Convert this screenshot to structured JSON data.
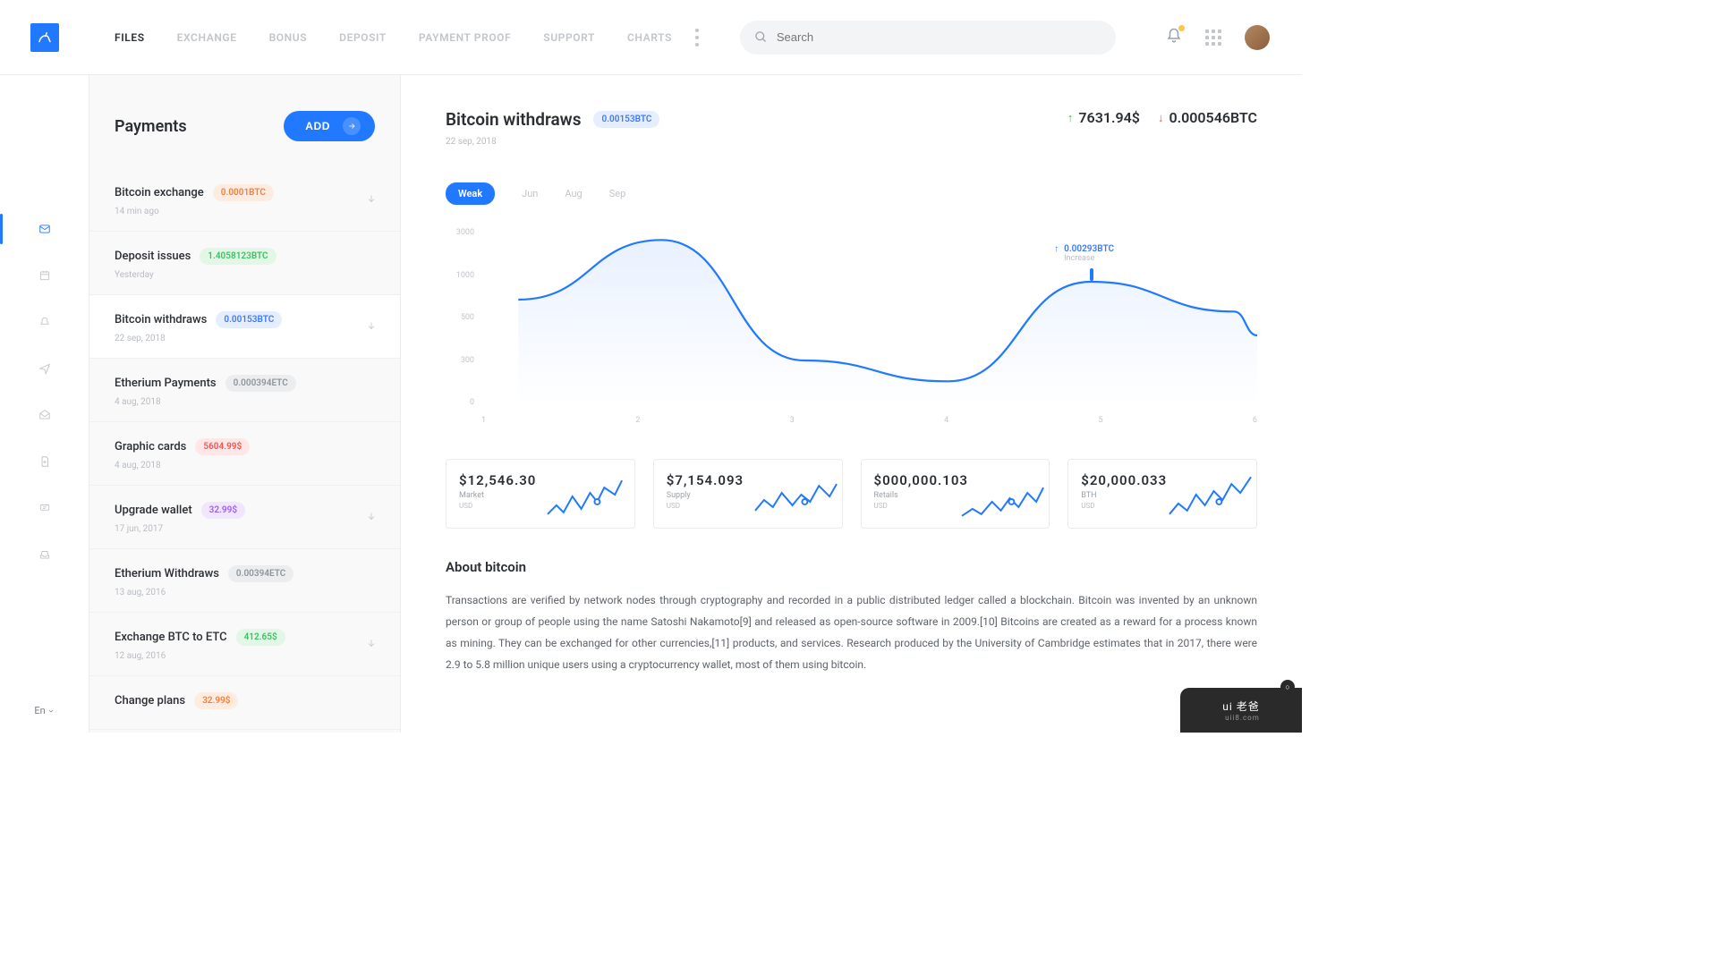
{
  "header": {
    "nav": [
      "FILES",
      "EXCHANGE",
      "BONUS",
      "DEPOSIT",
      "PAYMENT PROOF",
      "SUPPORT",
      "CHARTS"
    ],
    "active_nav": 0,
    "search_placeholder": "Search"
  },
  "rail": {
    "lang": "En"
  },
  "payments": {
    "title": "Payments",
    "add_label": "ADD",
    "items": [
      {
        "name": "Bitcoin exchange",
        "badge": "0.0001BTC",
        "badge_class": "b-orange",
        "date": "14 min ago",
        "arrow": true
      },
      {
        "name": "Deposit issues",
        "badge": "1.4058123BTC",
        "badge_class": "b-green",
        "date": "Yesterday",
        "arrow": false
      },
      {
        "name": "Bitcoin withdraws",
        "badge": "0.00153BTC",
        "badge_class": "b-blue",
        "date": "22 sep, 2018",
        "arrow": true,
        "selected": true
      },
      {
        "name": "Etherium Payments",
        "badge": "0.000394ETC",
        "badge_class": "b-grey",
        "date": "4 aug, 2018",
        "arrow": false
      },
      {
        "name": "Graphic cards",
        "badge": "5604.99$",
        "badge_class": "b-red",
        "date": "4 aug, 2018",
        "arrow": false
      },
      {
        "name": "Upgrade wallet",
        "badge": "32.99$",
        "badge_class": "b-purple",
        "date": "17 jun, 2017",
        "arrow": true
      },
      {
        "name": "Etherium Withdraws",
        "badge": "0.00394ETC",
        "badge_class": "b-grey",
        "date": "13 aug, 2016",
        "arrow": false
      },
      {
        "name": "Exchange BTC to ETC",
        "badge": "412.65$",
        "badge_class": "b-green",
        "date": "12 aug, 2016",
        "arrow": true
      },
      {
        "name": "Change plans",
        "badge": "32.99$",
        "badge_class": "b-orange",
        "date": "",
        "arrow": false
      }
    ]
  },
  "detail": {
    "title": "Bitcoin withdraws",
    "badge": "0.00153BTC",
    "date": "22 sep, 2018",
    "stat_up": "7631.94$",
    "stat_down": "0.000546BTC",
    "range_tabs": [
      "Weak",
      "Jun",
      "Aug",
      "Sep"
    ],
    "active_range": 0,
    "marker_value": "0.00293BTC",
    "marker_label": "Increase",
    "about_title": "About bitcoin",
    "about_body": "Transactions are verified by network nodes through cryptography and recorded in a public distributed ledger called a blockchain. Bitcoin was invented by an unknown person or group of people using the name Satoshi Nakamoto[9] and released as open-source software in 2009.[10] Bitcoins are created as a reward for a process known as mining. They can be exchanged for other currencies,[11] products, and services. Research produced by the University of Cambridge estimates that in 2017, there were 2.9 to 5.8 million unique users using a cryptocurrency wallet, most of them using bitcoin."
  },
  "chart_data": {
    "type": "line",
    "x": [
      1,
      2,
      3,
      4,
      5,
      6
    ],
    "values": [
      1800,
      2800,
      780,
      430,
      2100,
      1600
    ],
    "y_ticks": [
      3000,
      1000,
      500,
      300,
      0
    ],
    "x_ticks": [
      "1",
      "2",
      "3",
      "4",
      "5",
      "6"
    ],
    "ylim": [
      0,
      3000
    ]
  },
  "cards": [
    {
      "value": "$12,546.30",
      "label": "Market",
      "unit": "USD"
    },
    {
      "value": "$7,154.093",
      "label": "Supply",
      "unit": "USD"
    },
    {
      "value": "$000,000.103",
      "label": "Retails",
      "unit": "USD"
    },
    {
      "value": "$20,000.033",
      "label": "BTH",
      "unit": "USD"
    }
  ],
  "watermark": {
    "brand": "ui 老爸",
    "url": "uii8.com"
  }
}
